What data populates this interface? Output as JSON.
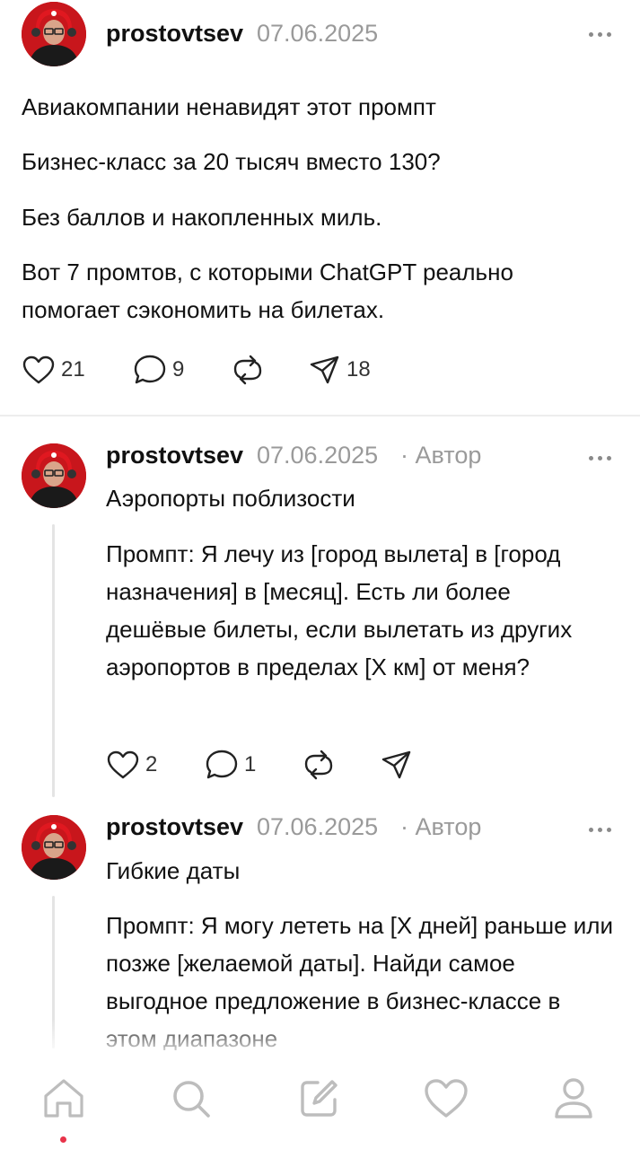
{
  "colors": {
    "accent_dot": "#e8334a",
    "avatar_bg": "#c8161c",
    "muted": "#9a9a9a"
  },
  "post": {
    "username": "prostovtsev",
    "date": "07.06.2025",
    "paragraphs": [
      "Авиакомпании ненавидят этот промпт",
      "Бизнес-класс за 20 тысяч вместо 130?",
      "Без баллов и накопленных миль.",
      "Вот 7 промтов, с которыми ChatGPT реально помогает сэкономить на билетах."
    ],
    "likes": "21",
    "comments": "9",
    "shares": "18"
  },
  "replies": [
    {
      "username": "prostovtsev",
      "date": "07.06.2025",
      "author_tag": "· Автор",
      "title": "Аэропорты поблизости",
      "body": "Промпт: Я лечу из [город вылета] в [город назначения] в [месяц]. Есть ли более дешёвые билеты, если вылетать из других аэропортов в пределах [X км] от меня?",
      "likes": "2",
      "comments": "1"
    },
    {
      "username": "prostovtsev",
      "date": "07.06.2025",
      "author_tag": "· Автор",
      "title": "Гибкие даты",
      "body": "Промпт: Я могу лететь на [X дней] раньше или позже [желаемой даты]. Найди самое выгодное предложение в бизнес-классе в этом диапазоне"
    }
  ],
  "nav": {
    "items": [
      "home-icon",
      "search-icon",
      "compose-icon",
      "heart-icon",
      "profile-icon"
    ],
    "active": "home-icon"
  }
}
